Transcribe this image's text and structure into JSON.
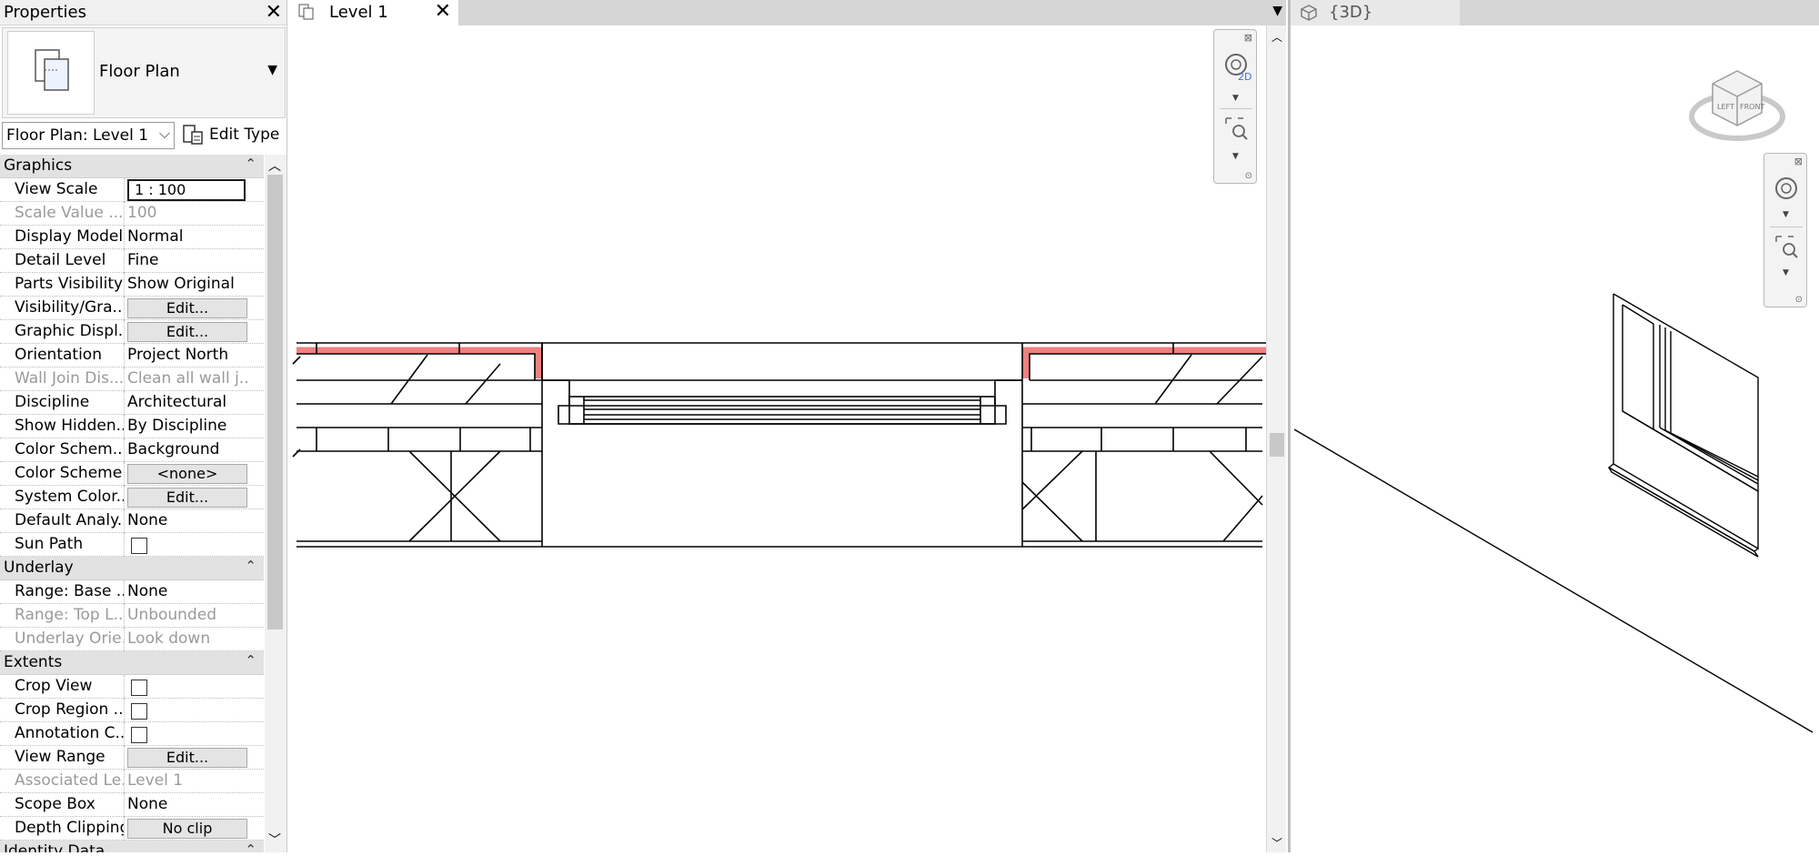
{
  "properties": {
    "title": "Properties",
    "type_name": "Floor Plan",
    "view_selector": "Floor Plan: Level 1",
    "edit_type_label": "Edit Type",
    "groups": [
      {
        "name": "Graphics",
        "rows": [
          {
            "key": "View Scale",
            "value": "1 : 100",
            "kind": "input"
          },
          {
            "key": "Scale Value ...",
            "value": "100",
            "kind": "text",
            "disabled": true
          },
          {
            "key": "Display Model",
            "value": "Normal",
            "kind": "text"
          },
          {
            "key": "Detail Level",
            "value": "Fine",
            "kind": "text"
          },
          {
            "key": "Parts Visibility",
            "value": "Show Original",
            "kind": "text"
          },
          {
            "key": "Visibility/Gra...",
            "value": "Edit...",
            "kind": "button"
          },
          {
            "key": "Graphic Displ...",
            "value": "Edit...",
            "kind": "button"
          },
          {
            "key": "Orientation",
            "value": "Project North",
            "kind": "text"
          },
          {
            "key": "Wall Join Dis...",
            "value": "Clean all wall j...",
            "kind": "text",
            "disabled": true
          },
          {
            "key": "Discipline",
            "value": "Architectural",
            "kind": "text"
          },
          {
            "key": "Show Hidden...",
            "value": "By Discipline",
            "kind": "text"
          },
          {
            "key": "Color Schem...",
            "value": "Background",
            "kind": "text"
          },
          {
            "key": "Color Scheme",
            "value": "<none>",
            "kind": "button"
          },
          {
            "key": "System Color...",
            "value": "Edit...",
            "kind": "button"
          },
          {
            "key": "Default Analy...",
            "value": "None",
            "kind": "text"
          },
          {
            "key": "Sun Path",
            "value": "",
            "kind": "checkbox"
          }
        ]
      },
      {
        "name": "Underlay",
        "rows": [
          {
            "key": "Range: Base ...",
            "value": "None",
            "kind": "text"
          },
          {
            "key": "Range: Top L...",
            "value": "Unbounded",
            "kind": "text",
            "disabled": true
          },
          {
            "key": "Underlay Orie...",
            "value": "Look down",
            "kind": "text",
            "disabled": true
          }
        ]
      },
      {
        "name": "Extents",
        "rows": [
          {
            "key": "Crop View",
            "value": "",
            "kind": "checkbox"
          },
          {
            "key": "Crop Region ...",
            "value": "",
            "kind": "checkbox"
          },
          {
            "key": "Annotation C...",
            "value": "",
            "kind": "checkbox"
          },
          {
            "key": "View Range",
            "value": "Edit...",
            "kind": "button"
          },
          {
            "key": "Associated Le...",
            "value": "Level 1",
            "kind": "text",
            "disabled": true
          },
          {
            "key": "Scope Box",
            "value": "None",
            "kind": "text"
          },
          {
            "key": "Depth Clipping",
            "value": "No clip",
            "kind": "button"
          }
        ]
      },
      {
        "name": "Identity Data",
        "rows": []
      }
    ]
  },
  "level_view": {
    "tab_label": "Level 1",
    "navbar_2d_label": "2D",
    "highlight_color": "#f08080"
  },
  "view_3d": {
    "tab_label": "{3D}",
    "viewcube_faces": [
      "LEFT",
      "FRONT"
    ]
  },
  "icons": [
    "close-icon",
    "floor-plan-type-icon",
    "edit-type-icon",
    "dropdown-arrow-icon",
    "collapse-icon",
    "floor-plan-tab-icon",
    "3d-view-tab-icon",
    "steering-wheel-icon",
    "zoom-region-icon",
    "viewcube-icon"
  ]
}
